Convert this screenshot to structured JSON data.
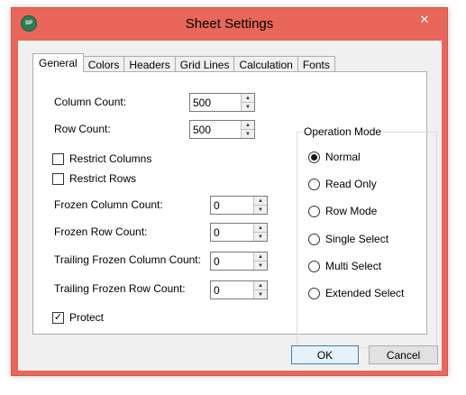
{
  "window": {
    "title": "Sheet Settings",
    "app_icon_text": "SP",
    "close_glyph": "✕",
    "accent_color": "#e8675a"
  },
  "tabs": [
    {
      "label": "General",
      "active": true
    },
    {
      "label": "Colors"
    },
    {
      "label": "Headers"
    },
    {
      "label": "Grid Lines"
    },
    {
      "label": "Calculation"
    },
    {
      "label": "Fonts"
    }
  ],
  "general": {
    "column_count": {
      "label": "Column Count:",
      "value": "500"
    },
    "row_count": {
      "label": "Row Count:",
      "value": "500"
    },
    "restrict_columns": {
      "label": "Restrict Columns",
      "checked": false
    },
    "restrict_rows": {
      "label": "Restrict Rows",
      "checked": false
    },
    "frozen_column_count": {
      "label": "Frozen Column Count:",
      "value": "0"
    },
    "frozen_row_count": {
      "label": "Frozen Row Count:",
      "value": "0"
    },
    "trailing_frozen_column_count": {
      "label": "Trailing Frozen Column Count:",
      "value": "0"
    },
    "trailing_frozen_row_count": {
      "label": "Trailing Frozen Row Count:",
      "value": "0"
    },
    "protect": {
      "label": "Protect",
      "checked": true,
      "check_glyph": "✓"
    }
  },
  "operation_mode": {
    "title": "Operation Mode",
    "options": [
      "Normal",
      "Read Only",
      "Row Mode",
      "Single Select",
      "Multi Select",
      "Extended Select"
    ],
    "selected": "Normal"
  },
  "buttons": {
    "ok": "OK",
    "cancel": "Cancel"
  },
  "spin_glyphs": {
    "up": "▲",
    "down": "▼"
  }
}
